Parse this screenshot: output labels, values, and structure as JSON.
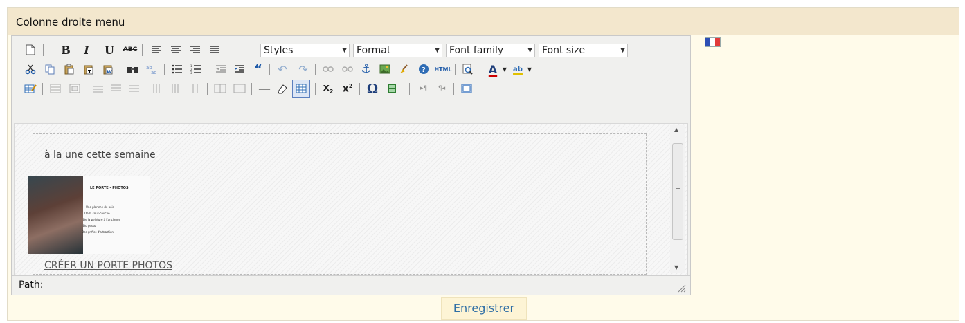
{
  "panel": {
    "title": "Colonne droite menu"
  },
  "toolbar": {
    "selects": {
      "styles": "Styles",
      "format": "Format",
      "font_family": "Font family",
      "font_size": "Font size"
    }
  },
  "content": {
    "heading_text": "à la une cette semaine",
    "thumbnail": {
      "title": "LE PORTE - PHOTOS",
      "lines": [
        "Une planche de bois",
        "De la sous-couche",
        "De la peinture à l'ancienne",
        "Du gesso",
        "Des griffes d'attraction"
      ]
    },
    "link_text": "CRÉER UN PORTE PHOTOS"
  },
  "status": {
    "path_label": "Path:"
  },
  "actions": {
    "save_label": "Enregistrer"
  },
  "flag": {
    "language": "fr",
    "colors": [
      "#2d4fb5",
      "#ffffff",
      "#e23a3a"
    ]
  }
}
